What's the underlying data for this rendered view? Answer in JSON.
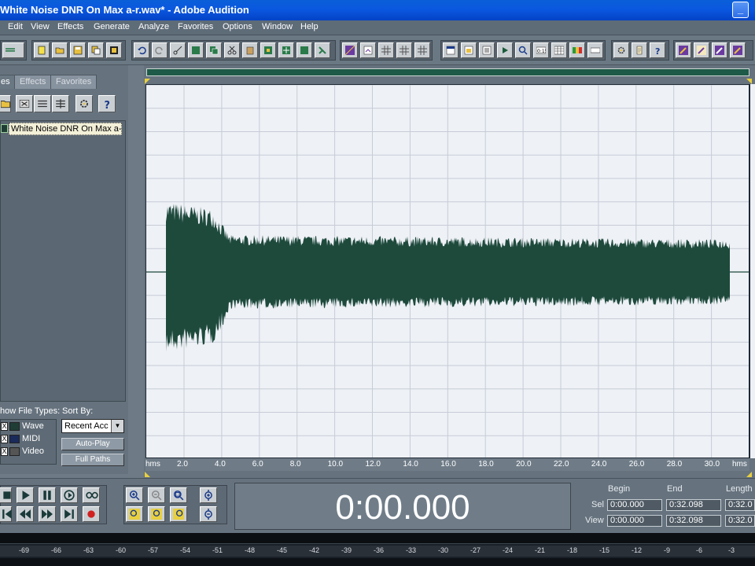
{
  "window": {
    "title": "White Noise DNR On Max a-r.wav* - Adobe Audition"
  },
  "menu": [
    "Edit",
    "View",
    "Effects",
    "Generate",
    "Analyze",
    "Favorites",
    "Options",
    "Window",
    "Help"
  ],
  "left_panel": {
    "tabs": [
      "es",
      "Effects",
      "Favorites"
    ],
    "files": [
      "White Noise DNR On Max a-r.wav"
    ],
    "show_file_types_label": "how File Types:",
    "sort_by_label": "Sort By:",
    "sort_value": "Recent Acc",
    "file_types": [
      {
        "label": "Wave",
        "checked": "X"
      },
      {
        "label": "MIDI",
        "checked": "X"
      },
      {
        "label": "Video",
        "checked": "X"
      }
    ],
    "auto_play": "Auto-Play",
    "full_paths": "Full Paths"
  },
  "ruler": {
    "unit": "hms",
    "ticks": [
      "2.0",
      "4.0",
      "6.0",
      "8.0",
      "10.0",
      "12.0",
      "14.0",
      "16.0",
      "18.0",
      "20.0",
      "22.0",
      "24.0",
      "26.0",
      "28.0",
      "30.0"
    ]
  },
  "time_display": "0:00.000",
  "sel_view": {
    "headers": {
      "begin": "Begin",
      "end": "End",
      "length": "Length"
    },
    "sel_label": "Sel",
    "view_label": "View",
    "sel": {
      "begin": "0:00.000",
      "end": "0:32.098",
      "length": "0:32.0"
    },
    "view": {
      "begin": "0:00.000",
      "end": "0:32.098",
      "length": "0:32.0"
    }
  },
  "meter": {
    "ticks": [
      "-69",
      "-66",
      "-63",
      "-60",
      "-57",
      "-54",
      "-51",
      "-48",
      "-45",
      "-42",
      "-39",
      "-36",
      "-33",
      "-30",
      "-27",
      "-24",
      "-21",
      "-18",
      "-15",
      "-12",
      "-9",
      "-6",
      "-3"
    ]
  },
  "colors": {
    "waveform": "#1e4a3c",
    "background": "#eef1f6",
    "grid": "#c6ccd6",
    "titlebar": "#0b58e0"
  }
}
